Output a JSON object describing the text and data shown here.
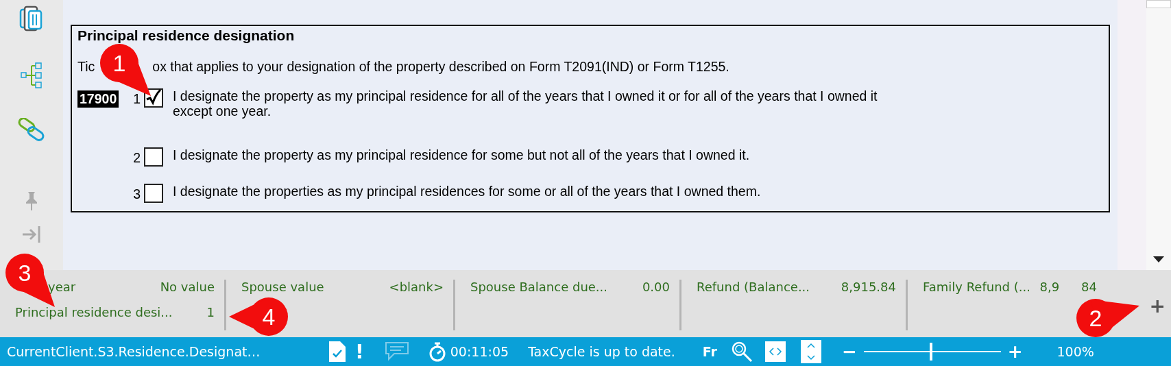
{
  "form": {
    "title": "Principal residence designation",
    "intro_start": "Tic",
    "intro_rest": "ox that applies to your designation of the property described on Form T2091(IND) or Form T1255.",
    "line_code": "17900",
    "options": [
      {
        "number": "1",
        "checked": true,
        "text": "I designate the property as my principal residence for all of the years that I owned it or for all of the years that I owned it except one year."
      },
      {
        "number": "2",
        "checked": false,
        "text": "I designate the property as my principal residence for some but not all of the years that I owned it."
      },
      {
        "number": "3",
        "checked": false,
        "text": "I designate the properties as my principal residences for some or all of the years that I owned them."
      }
    ]
  },
  "summary": {
    "columns": [
      {
        "entries": [
          {
            "label": "year",
            "value": "No value"
          },
          {
            "label": "Principal residence desi...",
            "value": "1"
          }
        ]
      },
      {
        "entries": [
          {
            "label": "Spouse value",
            "value": "<blank>"
          }
        ]
      },
      {
        "entries": [
          {
            "label": "Spouse Balance due...",
            "value": "0.00"
          }
        ]
      },
      {
        "entries": [
          {
            "label": "Refund (Balance...",
            "value": "8,915.84"
          }
        ]
      },
      {
        "entries": [
          {
            "label": "Family Refund (...",
            "value": "8,9",
            "value_tail": "84"
          }
        ]
      }
    ],
    "add_label": "+"
  },
  "status_bar": {
    "path": "CurrentClient.S3.Residence.Designat…",
    "alert": "!",
    "timer": "00:11:05",
    "message": "TaxCycle is up to date.",
    "language": "Fr",
    "zoom_out": "−",
    "zoom_in": "+",
    "zoom": {
      "level": 0.48
    },
    "zoom_text": "100%"
  },
  "callouts": [
    {
      "number": "1"
    },
    {
      "number": "2"
    },
    {
      "number": "3"
    },
    {
      "number": "4"
    }
  ]
}
